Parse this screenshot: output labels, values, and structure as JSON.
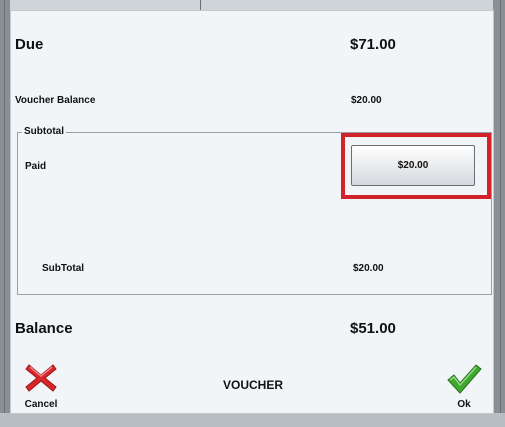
{
  "dialog": {
    "due_label": "Due",
    "due_value": "$71.00",
    "voucher_balance_label": "Voucher Balance",
    "voucher_balance_value": "$20.00",
    "subtotal_group_label": "Subtotal",
    "paid_label": "Paid",
    "paid_button_value": "$20.00",
    "subtotal_label": "SubTotal",
    "subtotal_value": "$20.00",
    "balance_label": "Balance",
    "balance_value": "$51.00",
    "title": "VOUCHER",
    "cancel_label": "Cancel",
    "ok_label": "Ok"
  },
  "colors": {
    "highlight": "#d2232a",
    "cancel_icon": "#d9262b",
    "ok_icon": "#3fa82e"
  },
  "icons": {
    "cancel": "x-icon",
    "ok": "checkmark-icon"
  }
}
